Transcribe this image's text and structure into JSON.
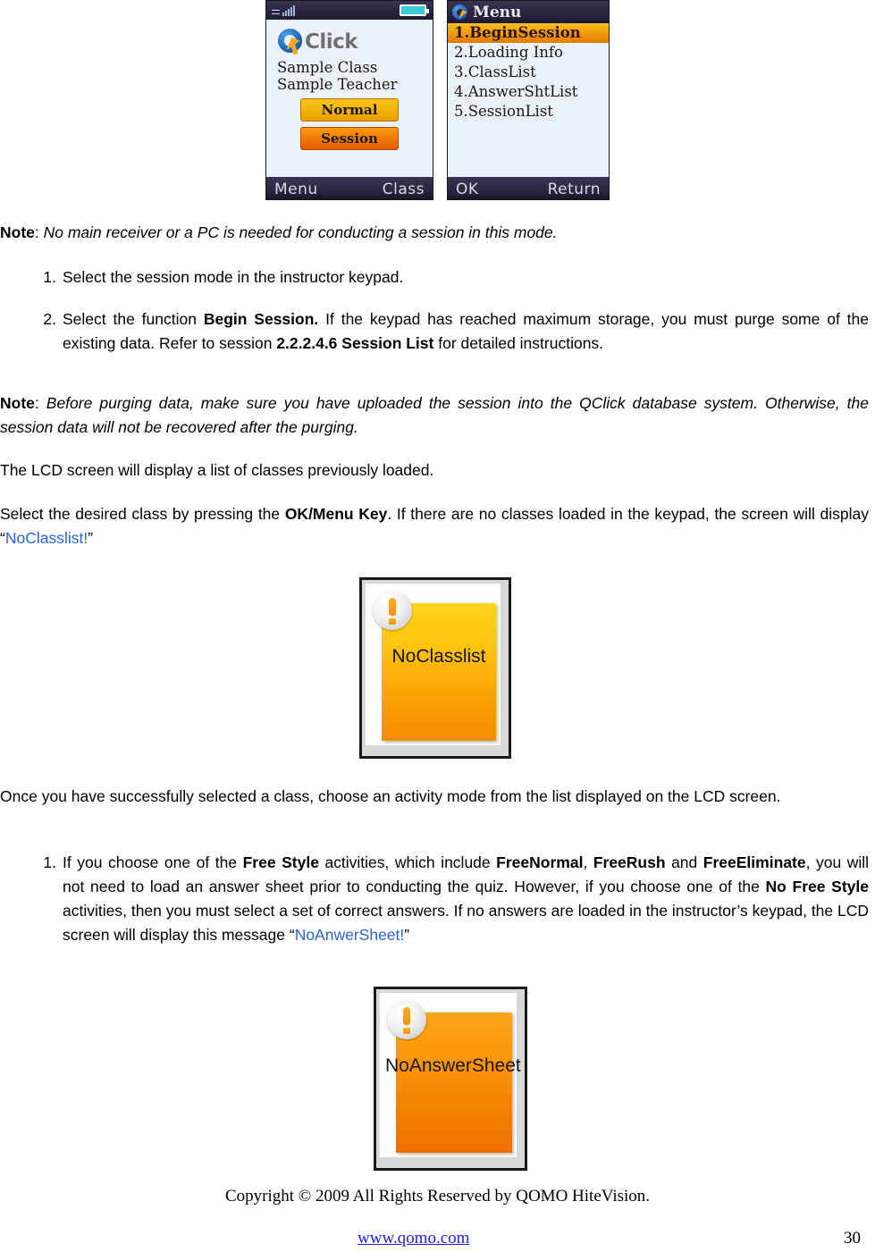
{
  "lcd_left": {
    "status": {
      "signal_icon": "signal-bars-icon",
      "battery_icon": "battery-full-icon"
    },
    "logo_text": "Click",
    "line1": "Sample Class",
    "line2": "Sample Teacher",
    "button_normal": "Normal",
    "button_session": "Session",
    "softkey_left": "Menu",
    "softkey_right": "Class"
  },
  "lcd_right": {
    "title": "Menu",
    "items": [
      {
        "label": "1.BeginSession",
        "selected": true
      },
      {
        "label": "2.Loading Info",
        "selected": false
      },
      {
        "label": "3.ClassList",
        "selected": false
      },
      {
        "label": "4.AnswerShtList",
        "selected": false
      },
      {
        "label": "5.SessionList",
        "selected": false
      }
    ],
    "softkey_left": "OK",
    "softkey_right": "Return"
  },
  "body": {
    "note1_label": "Note",
    "note1_sep": ": ",
    "note1_text": "No main receiver or a PC is needed for conducting a session in this mode.",
    "list1": [
      {
        "num": "1.",
        "parts": [
          {
            "text": "Select the session mode in the instructor keypad.",
            "style": "normal"
          }
        ]
      },
      {
        "num": "2.",
        "parts": [
          {
            "text": "Select the function ",
            "style": "normal"
          },
          {
            "text": "Begin Session.",
            "style": "bold"
          },
          {
            "text": " If the keypad has reached maximum storage, you must purge some of the existing data. Refer to session ",
            "style": "normal"
          },
          {
            "text": "2.2.2.4.6 Session List",
            "style": "bold"
          },
          {
            "text": " for detailed instructions.",
            "style": "normal"
          }
        ]
      }
    ],
    "note2_label": "Note",
    "note2_sep": ":  ",
    "note2_text": "Before purging data, make sure you have uploaded the session into the QClick database system. Otherwise, the session data will not be recovered after the purging.",
    "para_lcd_list": "The LCD screen will display a list of classes previously loaded.",
    "para_select": {
      "p1": "Select the desired class by pressing the ",
      "p2_bold": "OK/Menu Key",
      "p3": ". If there are no classes loaded in the keypad, the screen will display “",
      "p4_blue": "NoClasslist!",
      "p5": "”"
    },
    "para_once": "Once you have successfully selected a class, choose an activity mode from the list displayed on the LCD screen.",
    "list2": [
      {
        "num": "1.",
        "p1": "If you choose one of the ",
        "b1": "Free Style",
        "p2": " activities, which include ",
        "b2": "FreeNormal",
        "p3": ", ",
        "b3": "FreeRush",
        "p4": " and ",
        "b4": "FreeEliminate",
        "p5": ", you will not need to load an answer sheet prior to conducting the quiz. However, if you choose one of the ",
        "b5": "No Free Style",
        "p6": " activities, then you must select a set of correct answers. If no answers are loaded in the instructor’s keypad, the LCD screen will display this message “",
        "blue1": "NoAnwerSheet!",
        "p7": "”"
      }
    ]
  },
  "dialog_noclasslist": {
    "label": "NoClasslist",
    "icon": "warning-exclamation-icon",
    "accent": "#fbc50d"
  },
  "dialog_noanswersheet": {
    "label": "NoAnswerSheet",
    "icon": "warning-exclamation-icon",
    "accent": "#f89209"
  },
  "footer": {
    "copyright": "Copyright © 2009 All Rights Reserved by QOMO HiteVision.",
    "url": "www.qomo.com",
    "page_number": "30"
  }
}
